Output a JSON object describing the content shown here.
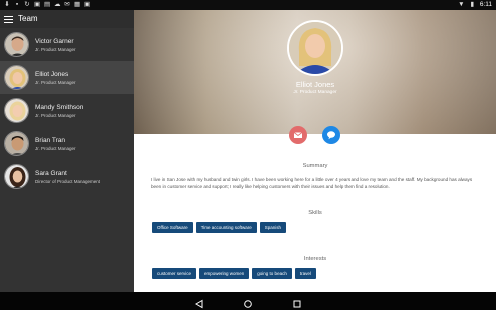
{
  "status_bar": {
    "left_icons": [
      "download-icon",
      "notification-icon",
      "sync-icon",
      "image-icon",
      "clipboard-icon",
      "cloud-icon",
      "mail-icon",
      "shop-icon",
      "photo-icon"
    ],
    "right_icons": [
      "wifi-icon",
      "battery-icon"
    ],
    "time": "6:11"
  },
  "app_bar": {
    "title": "Team"
  },
  "sidebar": {
    "contacts": [
      {
        "name": "Victor Garner",
        "role": "Jr. Product Manager"
      },
      {
        "name": "Elliot Jones",
        "role": "Jr. Product Manager"
      },
      {
        "name": "Mandy Smithson",
        "role": "Jr. Product Manager"
      },
      {
        "name": "Brian Tran",
        "role": "Jr. Product Manager"
      },
      {
        "name": "Sara Grant",
        "role": "Director of Product Management"
      }
    ],
    "selected_index": 1
  },
  "profile": {
    "name": "Elliot Jones",
    "role": "Jr. Product Manager",
    "summary_title": "Summary",
    "summary_text": "I live in San Jose with my husband and twin girls. I have been working here for a little over 4 years and love my team and the staff. My background has always been in customer service and support; I really like helping customers with their issues and help them find a resolution.",
    "skills_title": "Skills",
    "skills": [
      "Office Software",
      "Time accounting software",
      "Spanish"
    ],
    "interests_title": "Interests",
    "interests": [
      "customer service",
      "empowering women",
      "going to beach",
      "travel"
    ]
  },
  "colors": {
    "chip": "#164a7a",
    "mail_button": "#e26b6b",
    "chat_button": "#1e88e5",
    "sidebar": "#333333"
  }
}
